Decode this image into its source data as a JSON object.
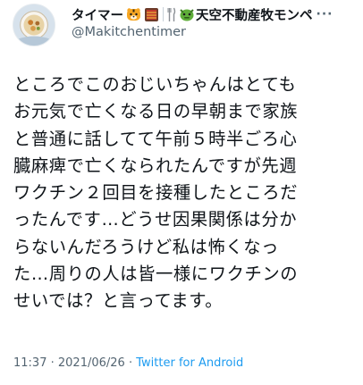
{
  "author": {
    "display_name": "タイマー",
    "name_suffix": "天空不動産牧モンペ",
    "handle": "@Makitchentimer"
  },
  "tweet": {
    "lines": [
      "ところでこのおじいちゃんはとても",
      "お元気で亡くなる日の早朝まで家族",
      "と普通に話してて午前５時半ごろ心",
      "臓麻痺で亡くなられたんですが先週",
      "ワクチン２回目を接種したところだ",
      "ったんです…どうせ因果関係は分か",
      "らないんだろうけど私は怖くなっ",
      "た…周りの人は皆一様にワクチンの",
      "せいでは？と言ってます。"
    ]
  },
  "meta": {
    "time": "11:37",
    "dot1": "·",
    "date": "2021/06/26",
    "dot2": "·",
    "source": "Twitter for Android"
  },
  "more_label": "···",
  "icons": [
    "tiger-emoji-icon",
    "grill-emoji-icon",
    "utensils-emoji-icon",
    "dragon-emoji-icon",
    "more-icon"
  ],
  "colors": {
    "text": "#0f1419",
    "secondary": "#536471",
    "link": "#1d9bf0"
  }
}
